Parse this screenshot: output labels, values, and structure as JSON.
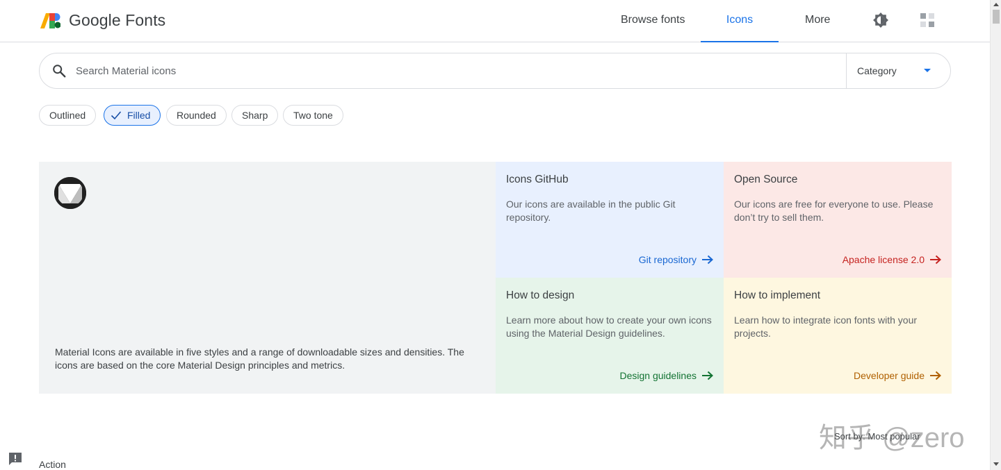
{
  "header": {
    "brand": "Google Fonts",
    "nav": {
      "browse": "Browse fonts",
      "icons": "Icons",
      "more": "More"
    },
    "accent_color": "#1a73e8",
    "icons": {
      "theme": "brightness-icon",
      "apps": "apps-grid-icon"
    }
  },
  "search": {
    "placeholder": "Search Material icons",
    "value": "",
    "category_label": "Category"
  },
  "styles": {
    "chips": [
      "Outlined",
      "Filled",
      "Rounded",
      "Sharp",
      "Two tone"
    ],
    "selected": "Filled"
  },
  "hero": {
    "description": "Material Icons are available in five styles and a range of downloadable sizes and densities. The icons are based on the core Material Design principles and metrics.",
    "cards": {
      "github": {
        "title": "Icons GitHub",
        "text": "Our icons are available in the public Git repository.",
        "link": "Git repository",
        "color": "#e8f0fe"
      },
      "oss": {
        "title": "Open Source",
        "text": "Our icons are free for everyone to use. Please don’t try to sell them.",
        "link": "Apache license 2.0",
        "color": "#fce8e6"
      },
      "design": {
        "title": "How to design",
        "text": "Learn more about how to create your own icons using the Material Design guidelines.",
        "link": "Design guidelines",
        "color": "#e6f4ea"
      },
      "impl": {
        "title": "How to implement",
        "text": "Learn how to integrate icon fonts with your projects.",
        "link": "Developer guide",
        "color": "#fef7e0"
      }
    }
  },
  "list": {
    "sort_label": "Sort by: Most popular",
    "section_title": "Action"
  },
  "watermark": "知乎 @zero"
}
